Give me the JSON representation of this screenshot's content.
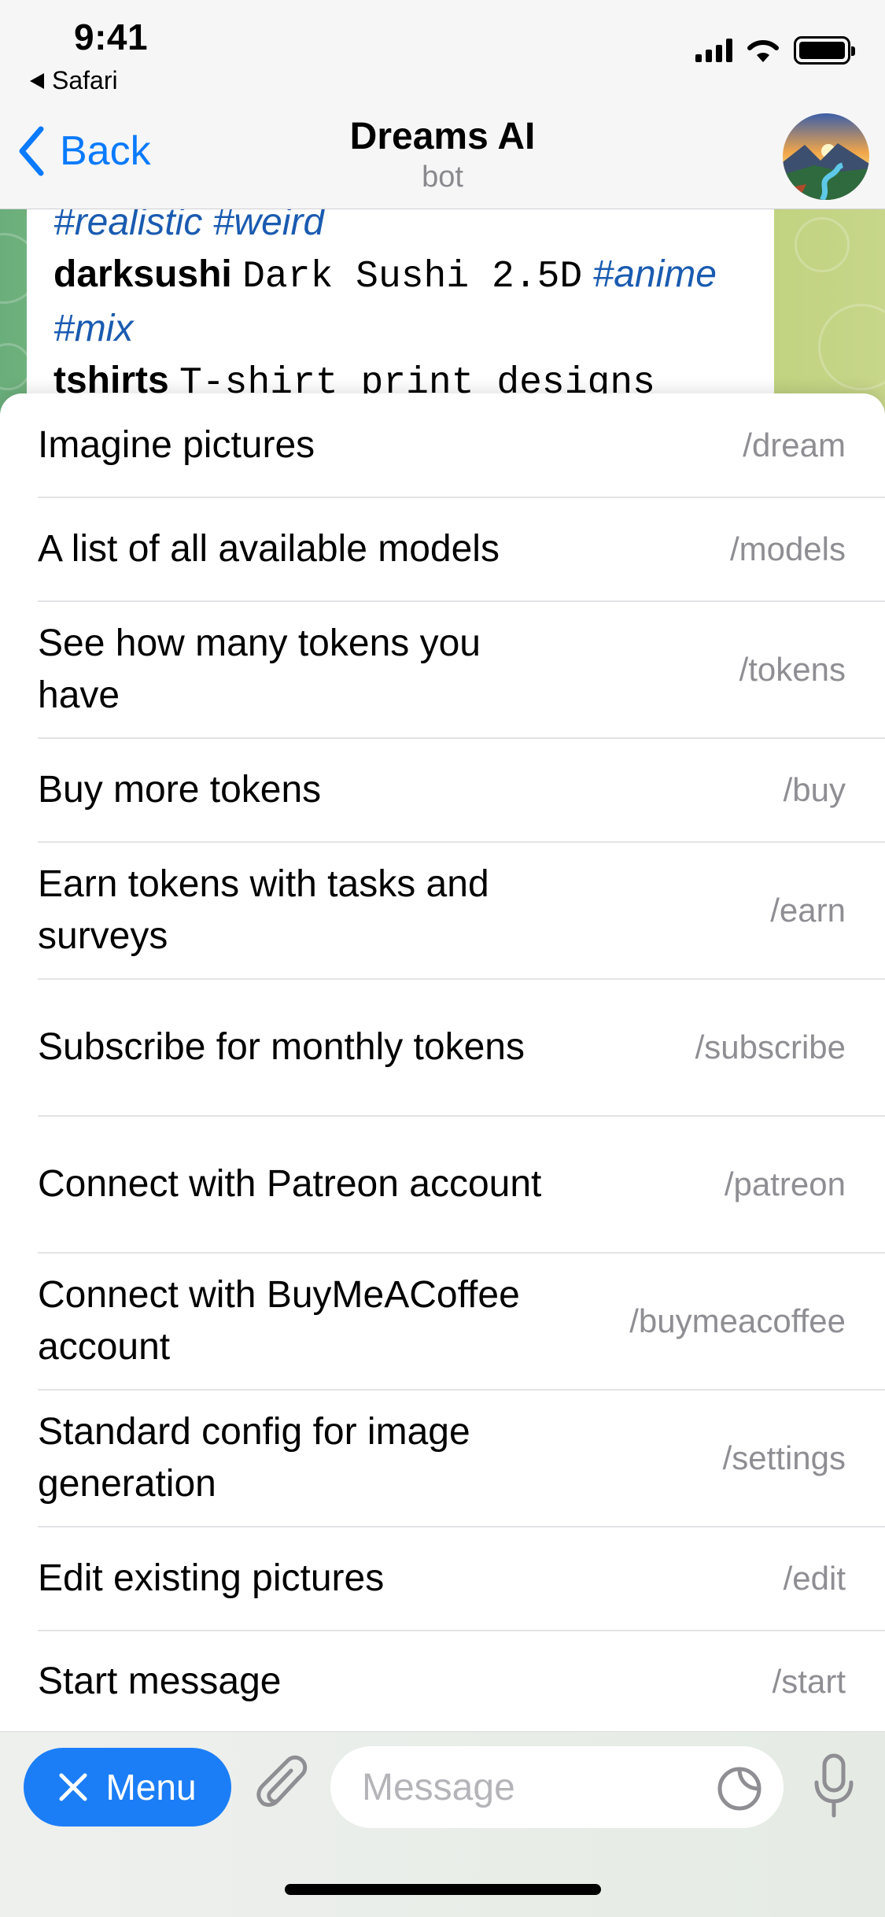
{
  "status_bar": {
    "time": "9:41",
    "back_app": "Safari"
  },
  "header": {
    "back_label": "Back",
    "title": "Dreams AI",
    "subtitle": "bot"
  },
  "message": {
    "line1_tags": "#realistic #weird",
    "line2_cmd": "darksushi",
    "line2_text": "Dark Sushi 2.5D",
    "line2_tag": "#anime",
    "line3_tag": "#mix",
    "line4_cmd": "tshirts",
    "line4_text": "T-shirt print designs"
  },
  "commands": [
    {
      "description": "Imagine pictures",
      "command": "/dream"
    },
    {
      "description": "A list of all available models",
      "command": "/models"
    },
    {
      "description": "See how many tokens you have",
      "command": "/tokens"
    },
    {
      "description": "Buy more tokens",
      "command": "/buy"
    },
    {
      "description": "Earn tokens with tasks and surveys",
      "command": "/earn"
    },
    {
      "description": "Subscribe for monthly tokens",
      "command": "/subscribe"
    },
    {
      "description": "Connect with Patreon account",
      "command": "/patreon"
    },
    {
      "description": "Connect with BuyMeACoffee account",
      "command": "/buymeacoffee"
    },
    {
      "description": "Standard config for image generation",
      "command": "/settings"
    },
    {
      "description": "Edit existing pictures",
      "command": "/edit"
    },
    {
      "description": "Start message",
      "command": "/start"
    }
  ],
  "input_bar": {
    "menu_label": "Menu",
    "message_placeholder": "Message"
  },
  "colors": {
    "accent": "#1b7ef7",
    "link": "#0a7aff",
    "hashtag": "#1a5bb0",
    "secondary_text": "#8e8e93"
  }
}
